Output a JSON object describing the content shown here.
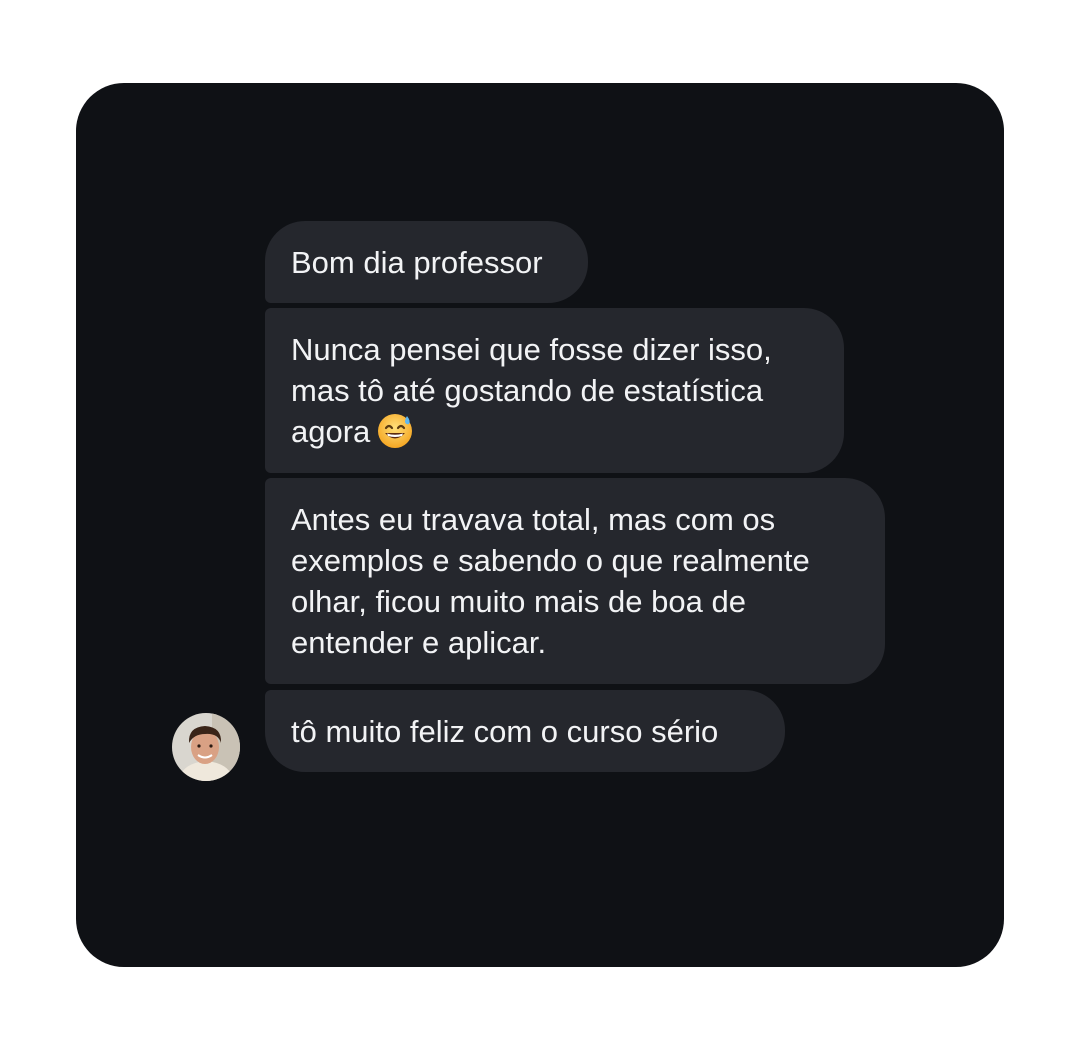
{
  "chat": {
    "messages": [
      {
        "lines": [
          "Bom dia professor"
        ]
      },
      {
        "lines": [
          "Nunca pensei que fosse dizer isso,",
          "mas tô até gostando de estatística",
          "agora"
        ],
        "emoji": "grinning-face-with-sweat-icon"
      },
      {
        "lines": [
          "Antes eu travava total, mas com os",
          "exemplos e sabendo o que realmente",
          "olhar, ficou muito mais de boa de",
          "entender e aplicar."
        ]
      },
      {
        "lines": [
          "tô muito feliz com o curso sério"
        ]
      }
    ],
    "avatar": "avatar-photo"
  },
  "colors": {
    "background": "#ffffff",
    "card": "#0f1115",
    "bubble": "#25272d",
    "text": "#f2f3f5"
  }
}
